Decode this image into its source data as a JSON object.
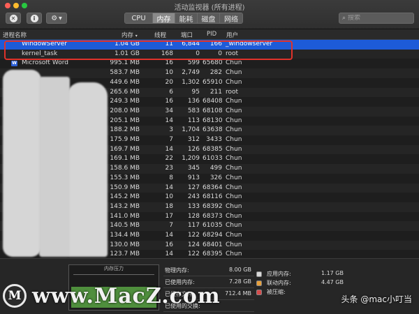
{
  "window": {
    "title": "活动监视器 (所有进程)"
  },
  "toolbar": {
    "tabs": [
      {
        "label": "CPU",
        "active": false
      },
      {
        "label": "内存",
        "active": true
      },
      {
        "label": "能耗",
        "active": false
      },
      {
        "label": "磁盘",
        "active": false
      },
      {
        "label": "网络",
        "active": false
      }
    ],
    "search_placeholder": "搜索",
    "icons": [
      "close-process-icon",
      "info-icon",
      "gear-icon",
      "chevron-down-icon",
      "search-icon"
    ]
  },
  "table": {
    "columns": {
      "name": "进程名称",
      "memory": "内存",
      "threads": "线程",
      "ports": "端口",
      "pid": "PID",
      "user": "用户"
    },
    "rows": [
      [
        "WindowServer",
        "1.04 GB",
        "11",
        "6,844",
        "166",
        "_windowserver"
      ],
      [
        "kernel_task",
        "1.01 GB",
        "168",
        "0",
        "0",
        "root"
      ],
      [
        "Microsoft Word",
        "995.1 MB",
        "16",
        "599",
        "65680",
        "Chun"
      ],
      [
        "",
        "583.7 MB",
        "10",
        "2,749",
        "282",
        "Chun"
      ],
      [
        "",
        "449.6 MB",
        "20",
        "1,302",
        "65910",
        "Chun"
      ],
      [
        "",
        "265.6 MB",
        "6",
        "95",
        "211",
        "root"
      ],
      [
        "",
        "249.3 MB",
        "16",
        "136",
        "68408",
        "Chun"
      ],
      [
        "",
        "208.0 MB",
        "34",
        "583",
        "68108",
        "Chun"
      ],
      [
        "",
        "205.1 MB",
        "14",
        "113",
        "68130",
        "Chun"
      ],
      [
        "",
        "188.2 MB",
        "3",
        "1,704",
        "63638",
        "Chun"
      ],
      [
        "",
        "175.9 MB",
        "7",
        "312",
        "3433",
        "Chun"
      ],
      [
        "",
        "169.7 MB",
        "14",
        "126",
        "68385",
        "Chun"
      ],
      [
        "",
        "169.1 MB",
        "22",
        "1,209",
        "61033",
        "Chun"
      ],
      [
        "",
        "158.6 MB",
        "23",
        "345",
        "499",
        "Chun"
      ],
      [
        "",
        "155.3 MB",
        "8",
        "913",
        "326",
        "Chun"
      ],
      [
        "",
        "150.9 MB",
        "14",
        "127",
        "68364",
        "Chun"
      ],
      [
        "",
        "145.2 MB",
        "10",
        "243",
        "68116",
        "Chun"
      ],
      [
        "",
        "143.2 MB",
        "18",
        "133",
        "68392",
        "Chun"
      ],
      [
        "",
        "141.0 MB",
        "17",
        "128",
        "68373",
        "Chun"
      ],
      [
        "",
        "140.5 MB",
        "7",
        "117",
        "61035",
        "Chun"
      ],
      [
        "",
        "134.4 MB",
        "14",
        "122",
        "68294",
        "Chun"
      ],
      [
        "",
        "130.0 MB",
        "16",
        "124",
        "68401",
        "Chun"
      ],
      [
        "",
        "123.7 MB",
        "14",
        "122",
        "68395",
        "Chun"
      ]
    ]
  },
  "bottom": {
    "pressure_label": "内存压力",
    "stats": [
      {
        "label": "物理内存:",
        "value": "8.00 GB"
      },
      {
        "label": "已使用内存:",
        "value": "7.28 GB"
      },
      {
        "label": "已缓存文件:",
        "value": "712.4 MB"
      },
      {
        "label": "已使用的交换:",
        "value": ""
      }
    ],
    "stats2": [
      {
        "label": "应用内存:",
        "value": "1.17 GB"
      },
      {
        "label": "联动内存:",
        "value": "4.47 GB"
      },
      {
        "label": "被压缩:",
        "value": ""
      }
    ]
  },
  "watermark": {
    "logo_letter": "M",
    "text": "www.MacZ.com"
  },
  "credit": "头条 @mac小叮当"
}
